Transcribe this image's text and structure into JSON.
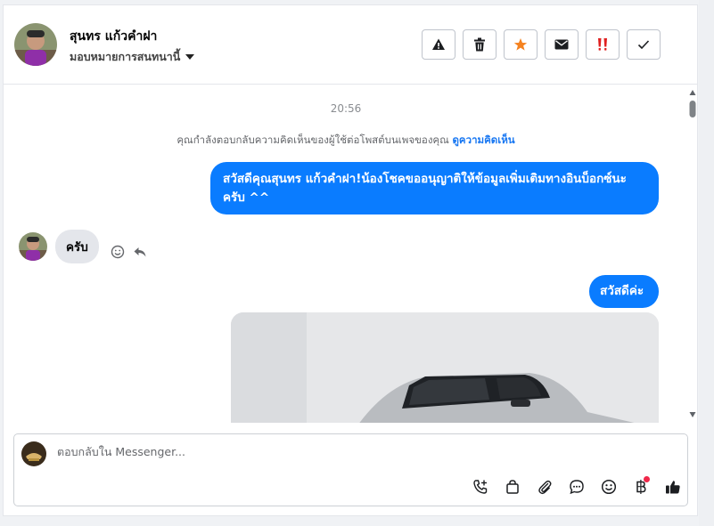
{
  "header": {
    "contact_name": "สุนทร แก้วคำฝา",
    "assign_label": "มอบหมายการสนทนานี้",
    "actions": [
      {
        "name": "spam-button",
        "icon": "warning-icon"
      },
      {
        "name": "delete-button",
        "icon": "trash-icon"
      },
      {
        "name": "follow-up-button",
        "icon": "star-icon",
        "color": "#f5821f"
      },
      {
        "name": "mark-unread-button",
        "icon": "envelope-icon"
      },
      {
        "name": "priority-button",
        "icon": "double-exclamation-icon",
        "color": "#e02020"
      },
      {
        "name": "mark-done-button",
        "icon": "check-icon"
      }
    ]
  },
  "thread": {
    "timestamp": "20:56",
    "notice_text": "คุณกำลังตอบกลับความคิดเห็นของผู้ใช้ต่อโพสต์บนเพจของคุณ",
    "notice_link": "ดูความคิดเห็น",
    "outgoing_1": "สวัสดีคุณสุนทร แก้วคำฝา!น้องโชคขออนุญาติให้ข้อมูลเพิ่มเติมทางอินบ็อกซ์นะครับ ^^",
    "incoming_1": "ครับ",
    "outgoing_2": "สวัสดีค่ะ",
    "bubble_color": "#0a7cff"
  },
  "composer": {
    "placeholder": "ตอบกลับใน Messenger...",
    "value": "",
    "tools": [
      "call-icon",
      "shopping-bag-icon",
      "attachment-icon",
      "saved-reply-icon",
      "emoji-icon",
      "baht-icon",
      "thumbs-up-icon"
    ]
  }
}
